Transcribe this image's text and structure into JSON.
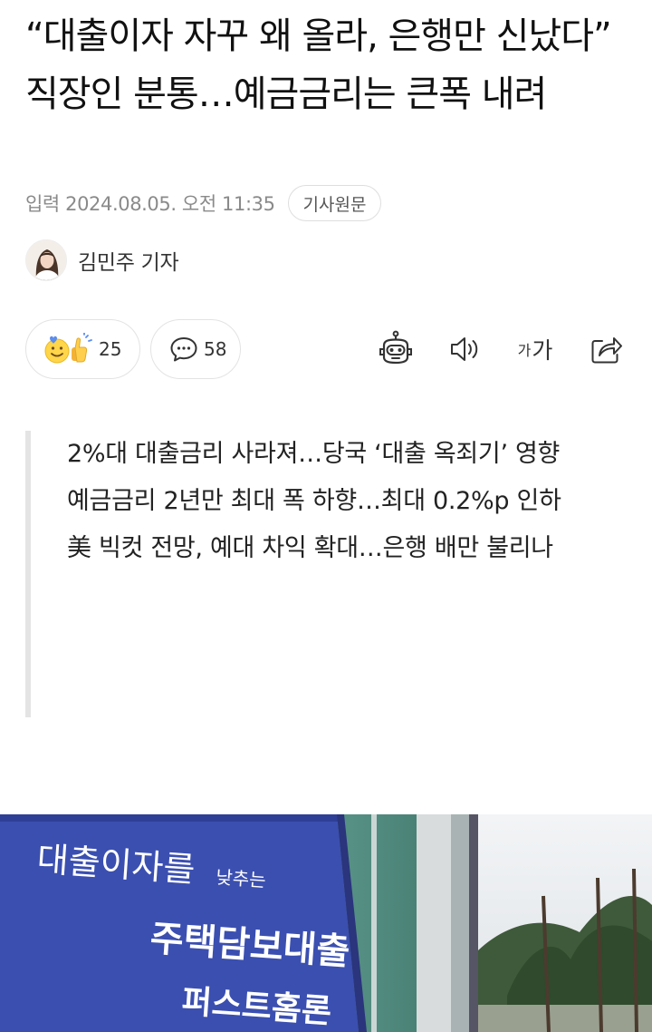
{
  "article": {
    "title": "“대출이자 자꾸 왜 올라, 은행만 신났다” 직장인 분통…예금금리는 큰폭 내려",
    "date": "입력 2024.08.05. 오전 11:35",
    "origin_button": "기사원문",
    "author": "김민주 기자"
  },
  "actions": {
    "reaction_count": "25",
    "comment_count": "58",
    "font_small": "가",
    "font_big": "가"
  },
  "summary": [
    "2%대 대출금리 사라져…당국 ‘대출 옥죄기’ 영향",
    "예금금리 2년만 최대 폭 하향…최대 0.2%p 인하",
    "美 빅컷 전망, 예대 차익 확대…은행 배만 불리나"
  ],
  "photo": {
    "banner_line1": "대출이자를",
    "banner_line1b": "낮추는",
    "banner_line2": "주택담보대출",
    "banner_line3": "퍼스트홈론"
  },
  "colors": {
    "banner_blue": "#3b4fb0",
    "divider_gray": "#e4e4e4"
  }
}
